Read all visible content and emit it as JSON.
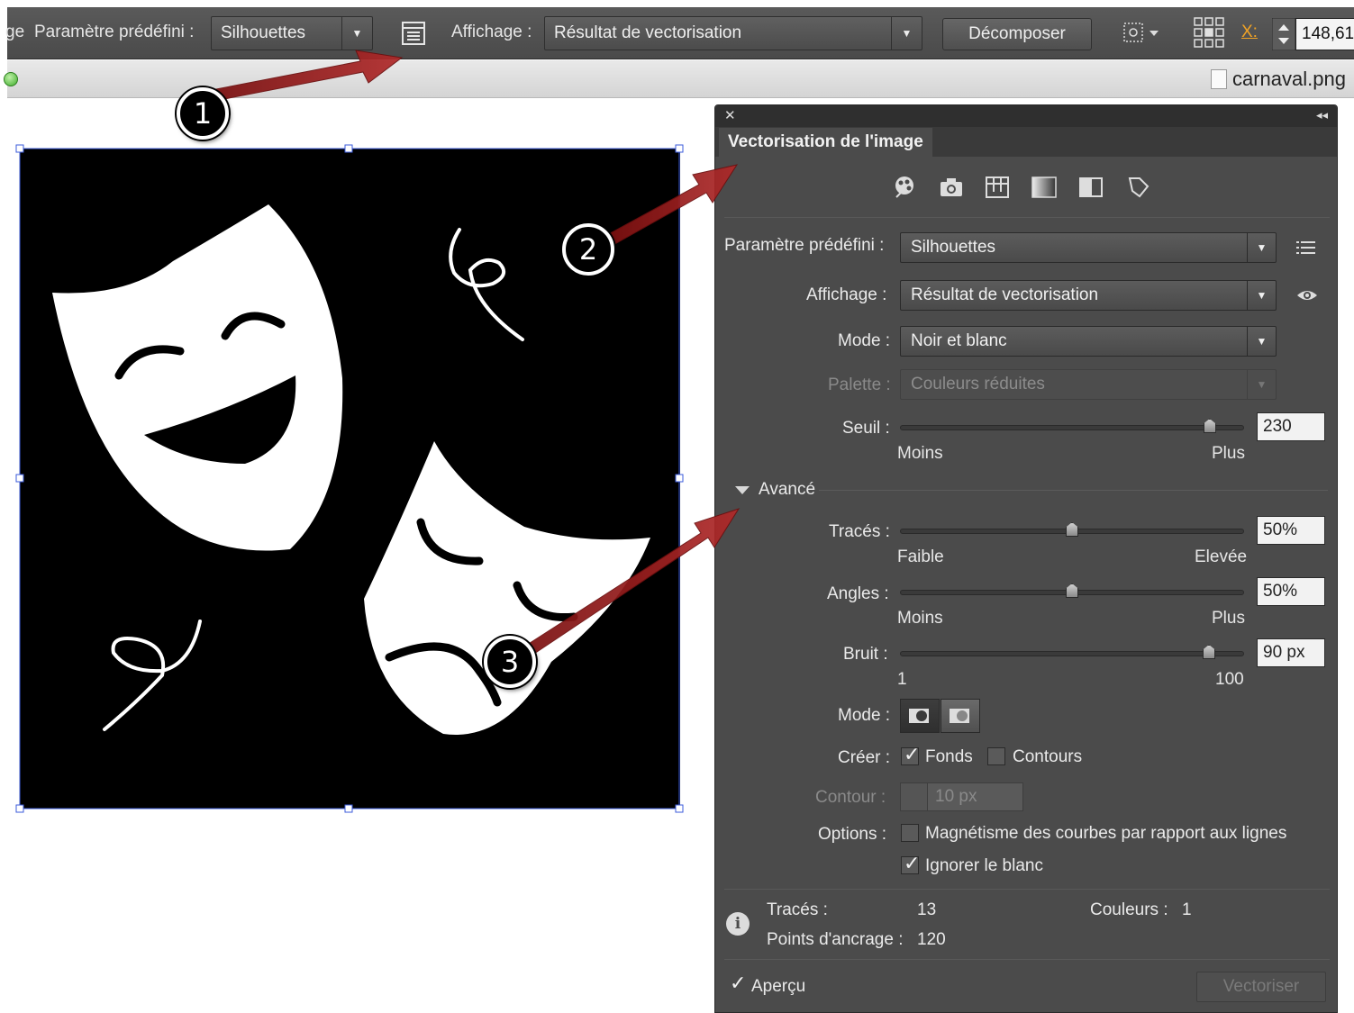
{
  "topbar": {
    "cut_label": "ge",
    "preset_label": "Paramètre prédéfini :",
    "preset_value": "Silhouettes",
    "view_label": "Affichage :",
    "view_value": "Résultat de vectorisation",
    "expand_button": "Décomposer",
    "x_label": "X:",
    "x_value": "148,61"
  },
  "document": {
    "filename": "carnaval.png"
  },
  "annotations": {
    "badge1": "1",
    "badge2": "2",
    "badge3": "3"
  },
  "panel": {
    "title": "Vectorisation de l'image",
    "preset_label": "Paramètre prédéfini :",
    "preset_value": "Silhouettes",
    "view_label": "Affichage :",
    "view_value": "Résultat de vectorisation",
    "mode_label": "Mode :",
    "mode_value": "Noir et blanc",
    "palette_label": "Palette :",
    "palette_value": "Couleurs réduites",
    "threshold_label": "Seuil :",
    "threshold_value": "230",
    "threshold_level": 230,
    "threshold_max": 255,
    "threshold_min_label": "Moins",
    "threshold_max_label": "Plus",
    "advanced_label": "Avancé",
    "paths_label": "Tracés :",
    "paths_value": "50%",
    "paths_level": 50,
    "paths_min_label": "Faible",
    "paths_max_label": "Elevée",
    "corners_label": "Angles :",
    "corners_value": "50%",
    "corners_level": 50,
    "corners_min_label": "Moins",
    "corners_max_label": "Plus",
    "noise_label": "Bruit :",
    "noise_value": "90 px",
    "noise_level": 90,
    "noise_min_label": "1",
    "noise_max_label": "100",
    "method_label": "Mode :",
    "create_label": "Créer :",
    "fills_label": "Fonds",
    "fills_checked": true,
    "strokes_label": "Contours",
    "strokes_checked": false,
    "stroke_label": "Contour :",
    "stroke_value": "10 px",
    "options_label": "Options :",
    "snap_label": "Magnétisme des courbes par rapport aux lignes",
    "snap_checked": false,
    "ignore_white_label": "Ignorer le blanc",
    "ignore_white_checked": true,
    "info_paths_label": "Tracés :",
    "info_paths_value": "13",
    "info_colors_label": "Couleurs :",
    "info_colors_value": "1",
    "info_anchors_label": "Points d'ancrage :",
    "info_anchors_value": "120",
    "preview_label": "Aperçu",
    "preview_checked": true,
    "trace_button": "Vectoriser"
  },
  "colors": {
    "panel_bg": "#4b4b4b",
    "arrow": "#9a1c1c",
    "selection": "#3b5bdb"
  }
}
